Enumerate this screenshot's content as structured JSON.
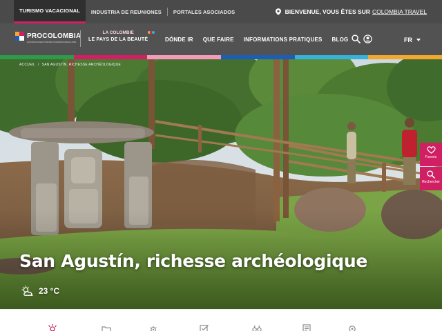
{
  "topbar": {
    "tabs": [
      {
        "label": "TURISMO VACACIONAL",
        "active": true
      },
      {
        "label": "INDUSTRIA DE REUNIONES",
        "active": false
      },
      {
        "label": "PORTALES ASOCIADOS",
        "active": false
      }
    ],
    "welcome_text": "BIENVENUE, VOUS ÊTES SUR",
    "welcome_link": "COLOMBIA TRAVEL",
    "pin_icon": "location-pin-icon"
  },
  "navbar": {
    "logo_text": "PROCOLOMBIA",
    "logo_tagline": "EXPORTACIONES TURISMO INVERSIÓN MARCA PAÍS",
    "campaign_line1": "LA COLOMBIE",
    "campaign_line2": "LE PAYS DE LA BEAUTÉ",
    "menu": [
      "DÓNDE IR",
      "QUE FAIRE",
      "INFORMATIONS PRATIQUES",
      "BLOG"
    ],
    "search_icon": "search-icon",
    "user_icon": "user-icon",
    "language": "FR"
  },
  "colors": {
    "accent": "#d01f63",
    "topbar_bg": "#4a4a4a",
    "navbar_bg": "#525252",
    "strip": [
      "#2e9a4a",
      "#d01f63",
      "#f29bbb",
      "#1a5fb4",
      "#37b2d8",
      "#f0a830"
    ]
  },
  "breadcrumb": [
    "ACCUEIL",
    "SAN AGUSTÍN, RICHESSE ARCHÉOLOGIQUE"
  ],
  "hero": {
    "title": "San Agustín, richesse archéologique",
    "temperature": "23 °C",
    "weather_icon": "partly-cloudy-icon"
  },
  "side_buttons": [
    {
      "label": "Favoris",
      "icon": "heart-icon"
    },
    {
      "label": "Rechercher",
      "icon": "search-icon"
    }
  ],
  "categories": [
    {
      "icon": "sun-icon",
      "active": true
    },
    {
      "icon": "folder-icon",
      "active": false
    },
    {
      "icon": "gear-icon",
      "active": false
    },
    {
      "icon": "checklist-icon",
      "active": false
    },
    {
      "icon": "binoculars-icon",
      "active": false
    },
    {
      "icon": "document-icon",
      "active": false
    },
    {
      "icon": "compass-icon",
      "active": false
    }
  ]
}
